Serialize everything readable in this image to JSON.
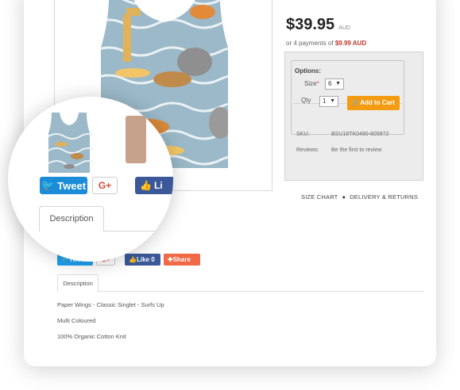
{
  "product": {
    "price": "$39.95",
    "currency": "AUD",
    "installments_prefix": "or 4 payments of",
    "installment_amount": "$9.99 AUD"
  },
  "options": {
    "title": "Options:",
    "size_label": "Size",
    "size_value": "6",
    "qty_label": "Qty",
    "qty_value": "1",
    "add_to_cart": "Add to Cart",
    "sku_label": "SKU:",
    "sku_value": "BSU18TK0480-605972",
    "reviews_label": "Reviews:",
    "reviews_value": "Be the first to review"
  },
  "links": {
    "size_chart": "SIZE CHART",
    "delivery": "DELIVERY & RETURNS"
  },
  "social": {
    "tweet": "Tweet",
    "gplus": "G+",
    "like": "Like 0",
    "share": "Share"
  },
  "tabs": {
    "description": "Description"
  },
  "description": {
    "lines": [
      "Paper Wings - Classic Singlet - Surfs Up",
      "Multi Coloured",
      "100% Organic Cotton Knit"
    ]
  },
  "magnifier": {
    "tweet": "Tweet",
    "gplus": "G+",
    "like": "Li",
    "tab": "Description"
  },
  "colors": {
    "accent": "#f39c12",
    "twitter": "#1da1f2",
    "facebook": "#3b5998",
    "share": "#f06846",
    "price_highlight": "#c0392b"
  }
}
